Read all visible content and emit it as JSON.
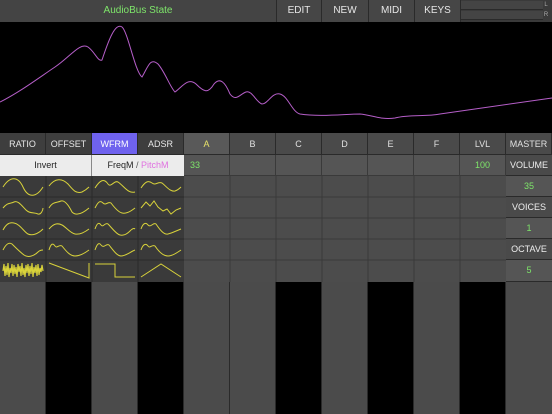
{
  "header": {
    "title": "AudioBus State",
    "buttons": [
      "EDIT",
      "NEW",
      "MIDI",
      "KEYS"
    ],
    "meter_labels": [
      "L",
      "R"
    ]
  },
  "tabs": [
    "RATIO",
    "OFFSET",
    "WFRM",
    "ADSR"
  ],
  "active_tab": "WFRM",
  "columns": [
    "A",
    "B",
    "C",
    "D",
    "E",
    "F"
  ],
  "active_column": "A",
  "lvl": {
    "label": "LVL",
    "value": "100"
  },
  "column_a_value": "33",
  "wave_panel": {
    "invert_label": "Invert",
    "freqm_label": "FreqM",
    "separator": "/",
    "pitchm_label": "PitchM"
  },
  "master": {
    "label": "MASTER",
    "volume_label": "VOLUME",
    "volume_value": "35",
    "voices_label": "VOICES",
    "voices_value": "1",
    "octave_label": "OCTAVE",
    "octave_value": "5"
  },
  "colors": {
    "accent_green": "#7ee56a",
    "tab_active": "#6f62ee",
    "wave_yellow": "#d8d23a",
    "pitchm_pink": "#e070e0",
    "display_curve": "#b55ec8"
  },
  "waveform_icons": [
    "sine-wave-icon",
    "sine-bump-wave-icon",
    "dual-peak-wave-icon",
    "ripple-wave-icon",
    "bumpy-wave-icon",
    "wobble-wave-icon",
    "harmonic-wave-icon",
    "zigzag-wave-icon",
    "arch-wave-icon",
    "wave-arch-icon",
    "organ-wave-icon",
    "pulse-harmonic-wave-icon",
    "trumpet-wave-icon",
    "buzz-wave-icon",
    "reed-wave-icon",
    "bell-wave-icon",
    "noise-wave-icon",
    "saw-wave-icon",
    "square-wave-icon",
    "triangle-wave-icon"
  ]
}
